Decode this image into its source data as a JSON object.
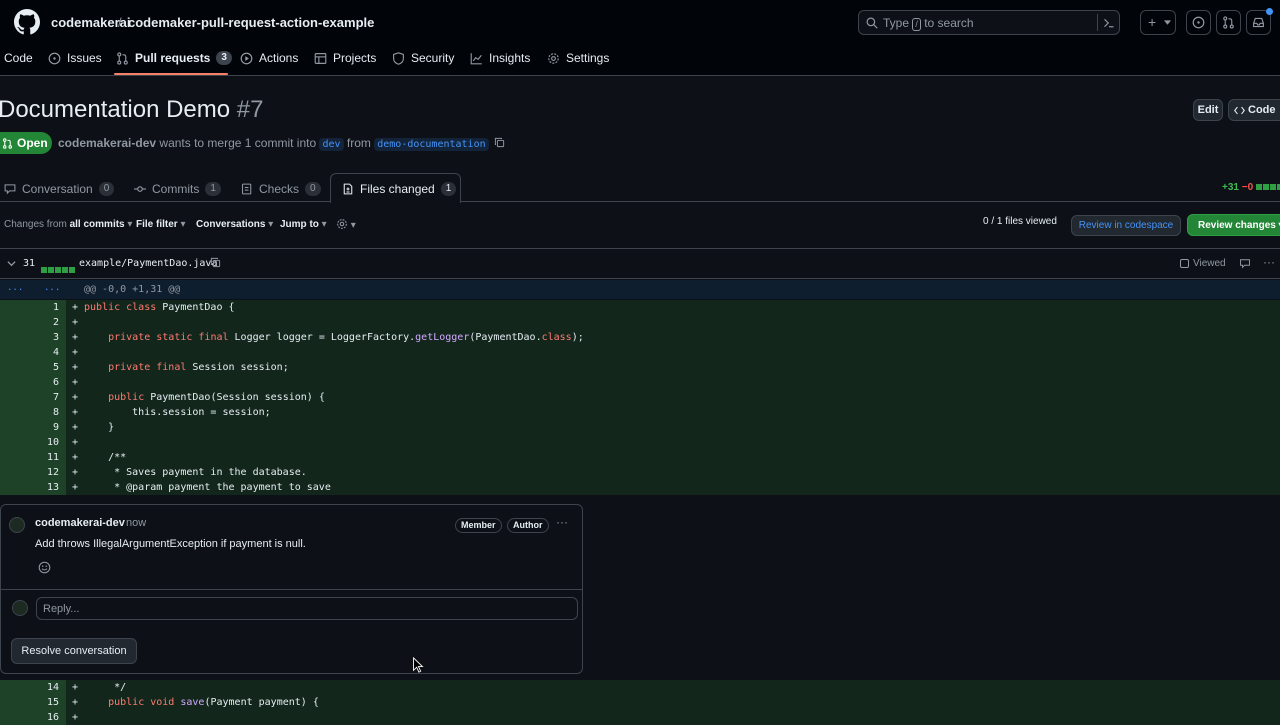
{
  "header": {
    "owner": "codemakerai",
    "separator": "/",
    "repo": "codemaker-pull-request-action-example",
    "search_prefix": "Type",
    "search_key": "/",
    "search_suffix": "to search",
    "plus": "+"
  },
  "nav": {
    "code": "Code",
    "issues": "Issues",
    "pull_requests": "Pull requests",
    "pull_requests_count": "3",
    "actions": "Actions",
    "projects": "Projects",
    "security": "Security",
    "insights": "Insights",
    "settings": "Settings"
  },
  "pr": {
    "title": "Documentation Demo",
    "number": "#7",
    "edit": "Edit",
    "code_btn": "Code",
    "state": "Open",
    "author": "codemakerai-dev",
    "merge_text": "wants to merge 1 commit into",
    "base_branch": "dev",
    "from_text": "from",
    "head_branch": "demo-documentation"
  },
  "tabs": {
    "conversation": "Conversation",
    "conversation_count": "0",
    "commits": "Commits",
    "commits_count": "1",
    "checks": "Checks",
    "checks_count": "0",
    "files": "Files changed",
    "files_count": "1",
    "additions": "+31",
    "deletions": "−0"
  },
  "filters": {
    "changes_prefix": "Changes from",
    "changes_value": "all commits",
    "file_filter": "File filter",
    "conversations": "Conversations",
    "jump_to": "Jump to",
    "viewed": "0 / 1 files viewed",
    "codespace": "Review in codespace",
    "review": "Review changes"
  },
  "file": {
    "lines": "31",
    "path": "example/PaymentDao.java",
    "viewed_label": "Viewed",
    "hunk": "@@ -0,0 +1,31 @@",
    "expand": "...",
    "plus_sign": "+"
  },
  "diff_lines": [
    {
      "n": "1",
      "code": "public class PaymentDao {"
    },
    {
      "n": "2",
      "code": ""
    },
    {
      "n": "3",
      "code": "    private static final Logger logger = LoggerFactory.getLogger(PaymentDao.class);"
    },
    {
      "n": "4",
      "code": ""
    },
    {
      "n": "5",
      "code": "    private final Session session;"
    },
    {
      "n": "6",
      "code": ""
    },
    {
      "n": "7",
      "code": "    public PaymentDao(Session session) {"
    },
    {
      "n": "8",
      "code": "        this.session = session;"
    },
    {
      "n": "9",
      "code": "    }"
    },
    {
      "n": "10",
      "code": ""
    },
    {
      "n": "11",
      "code": "    /**"
    },
    {
      "n": "12",
      "code": "     * Saves payment in the database."
    },
    {
      "n": "13",
      "code": "     * @param payment the payment to save"
    },
    {
      "n": "14",
      "code": "     */"
    },
    {
      "n": "15",
      "code": "    public void save(Payment payment) {"
    },
    {
      "n": "16",
      "code": ""
    }
  ],
  "comment": {
    "author": "codemakerai-dev",
    "time": "now",
    "member": "Member",
    "author_badge": "Author",
    "more": "···",
    "body": "Add throws IllegalArgumentException if payment is null.",
    "reply_placeholder": "Reply...",
    "resolve": "Resolve conversation"
  }
}
